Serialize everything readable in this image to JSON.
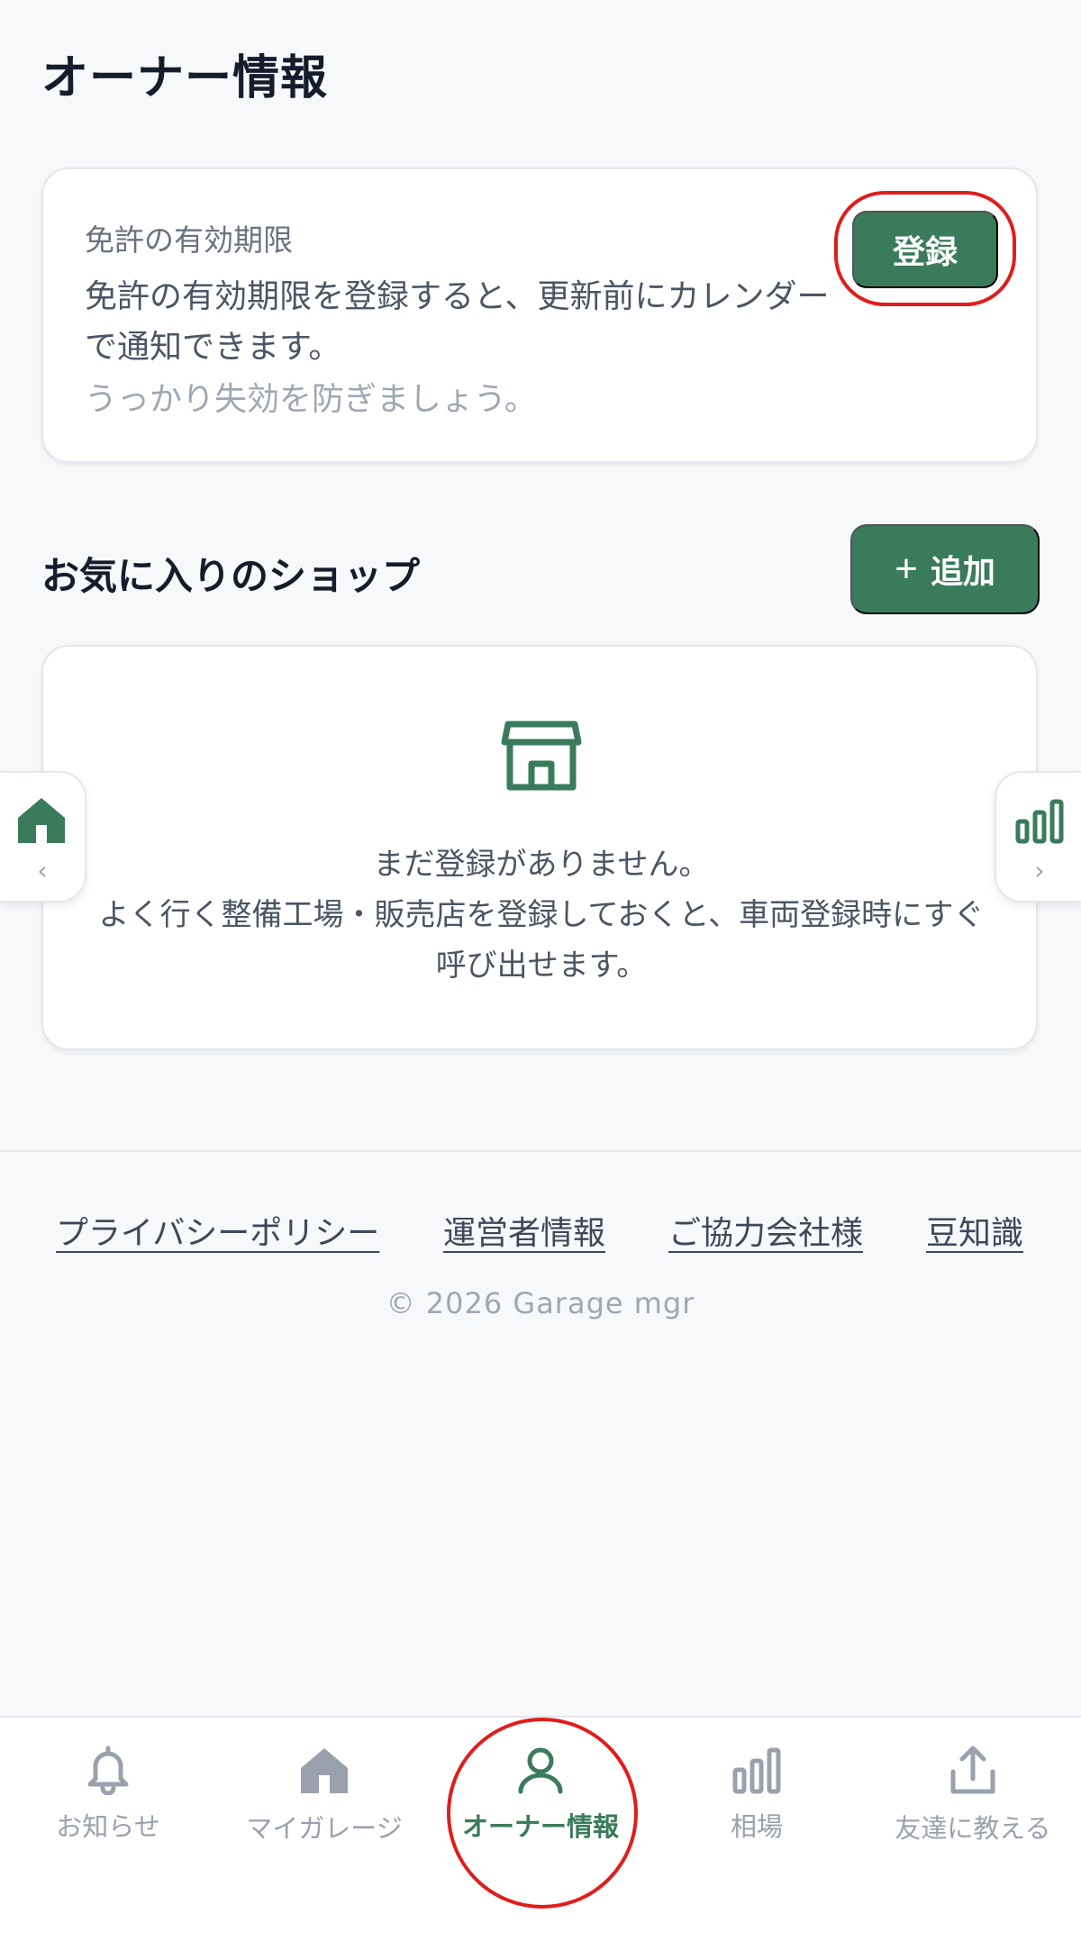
{
  "page": {
    "title": "オーナー情報"
  },
  "license": {
    "label": "免許の有効期限",
    "description": "免許の有効期限を登録すると、更新前にカレンダーで通知できます。",
    "hint": "うっかり失効を防ぎましょう。",
    "register_label": "登録"
  },
  "shops": {
    "title": "お気に入りのショップ",
    "add_label": "追加",
    "add_icon": "plus-icon",
    "empty_icon": "store-icon",
    "empty_line1": "まだ登録がありません。",
    "empty_line2": "よく行く整備工場・販売店を登録しておくと、車両登録時にすぐ呼び出せます。"
  },
  "side_tabs": {
    "left": {
      "icon": "house-icon",
      "chevron": "‹"
    },
    "right": {
      "icon": "bar-chart-icon",
      "chevron": "›"
    }
  },
  "footer": {
    "links": [
      "プライバシーポリシー",
      "運営者情報",
      "ご協力会社様",
      "豆知識"
    ],
    "copyright": "© 2026 Garage mgr"
  },
  "nav": {
    "items": [
      {
        "label": "お知らせ",
        "icon": "bell-icon",
        "active": false
      },
      {
        "label": "マイガレージ",
        "icon": "house-icon",
        "active": false
      },
      {
        "label": "オーナー情報",
        "icon": "person-icon",
        "active": true
      },
      {
        "label": "相場",
        "icon": "bar-chart-icon",
        "active": false
      },
      {
        "label": "友達に教える",
        "icon": "share-icon",
        "active": false
      }
    ]
  },
  "colors": {
    "accent": "#3a7b5c",
    "highlight": "#e01d1d",
    "muted": "#9aa1ac"
  }
}
